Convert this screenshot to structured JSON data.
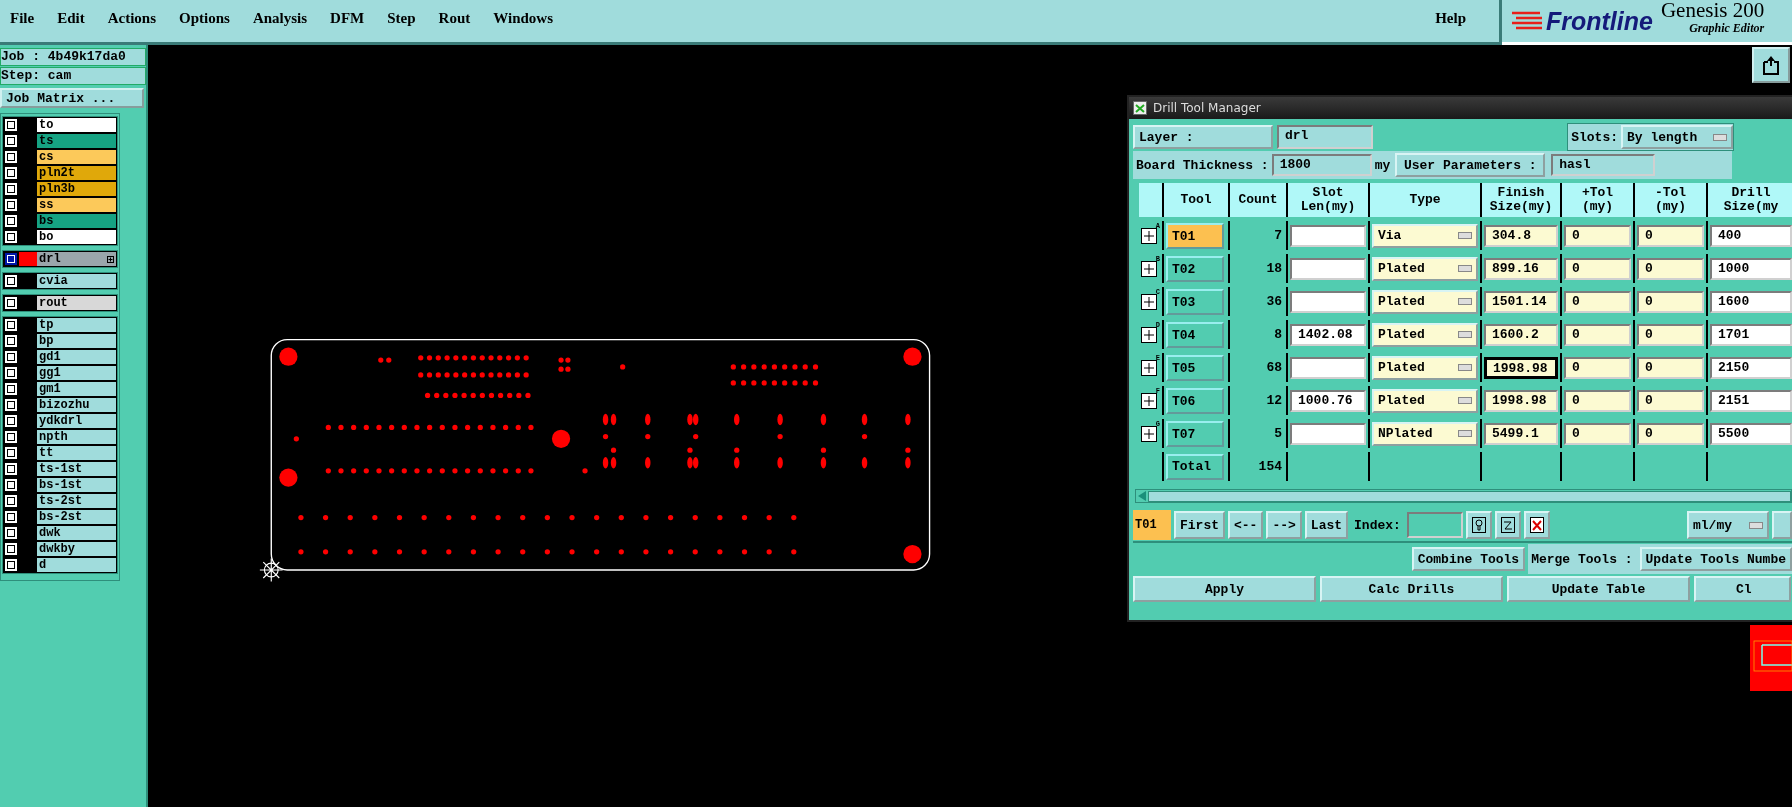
{
  "menu": [
    {
      "label": "File"
    },
    {
      "label": "Edit"
    },
    {
      "label": "Actions"
    },
    {
      "label": "Options"
    },
    {
      "label": "Analysis"
    },
    {
      "label": "DFM"
    },
    {
      "label": "Step"
    },
    {
      "label": "Rout"
    },
    {
      "label": "Windows"
    }
  ],
  "help": "Help",
  "brand": {
    "logo": "Frontline",
    "product": "Genesis 200",
    "subtitle": "Graphic Editor"
  },
  "job": {
    "job": "Job : 4b49k17da0",
    "step": "Step: cam",
    "matrix_button": "Job Matrix ..."
  },
  "layer_groups": [
    {
      "layers": [
        {
          "name": "to",
          "color": "#ffffff",
          "selected": false
        },
        {
          "name": "ts",
          "color": "#16a383",
          "selected": false
        },
        {
          "name": "cs",
          "color": "#fcc95a",
          "selected": false
        },
        {
          "name": "pln2t",
          "color": "#e0a80a",
          "selected": false
        },
        {
          "name": "pln3b",
          "color": "#e0a80a",
          "selected": false
        },
        {
          "name": "ss",
          "color": "#fcc95a",
          "selected": false
        },
        {
          "name": "bs",
          "color": "#16a383",
          "selected": false
        },
        {
          "name": "bo",
          "color": "#ffffff",
          "selected": false
        }
      ]
    },
    {
      "layers": [
        {
          "name": "drl",
          "color": "#9aa6ac",
          "selected": true
        }
      ]
    },
    {
      "layers": [
        {
          "name": "cvia",
          "color": "#a0dcdc",
          "selected": false
        }
      ]
    },
    {
      "layers": [
        {
          "name": "rout",
          "color": "#d8d8d8",
          "selected": false
        }
      ]
    },
    {
      "layers": [
        {
          "name": "tp",
          "color": "#a0dcdc",
          "selected": false
        },
        {
          "name": "bp",
          "color": "#a0dcdc",
          "selected": false
        },
        {
          "name": "gd1",
          "color": "#a0dcdc",
          "selected": false
        },
        {
          "name": "gg1",
          "color": "#a0dcdc",
          "selected": false
        },
        {
          "name": "gm1",
          "color": "#a0dcdc",
          "selected": false
        },
        {
          "name": "bizozhu",
          "color": "#a0dcdc",
          "selected": false
        },
        {
          "name": "ydkdrl",
          "color": "#a0dcdc",
          "selected": false
        },
        {
          "name": "npth",
          "color": "#a0dcdc",
          "selected": false
        },
        {
          "name": "tt",
          "color": "#a0dcdc",
          "selected": false
        },
        {
          "name": "ts-1st",
          "color": "#a0dcdc",
          "selected": false
        },
        {
          "name": "bs-1st",
          "color": "#a0dcdc",
          "selected": false
        },
        {
          "name": "ts-2st",
          "color": "#a0dcdc",
          "selected": false
        },
        {
          "name": "bs-2st",
          "color": "#a0dcdc",
          "selected": false
        },
        {
          "name": "dwk",
          "color": "#a0dcdc",
          "selected": false
        },
        {
          "name": "dwkby",
          "color": "#a0dcdc",
          "selected": false
        },
        {
          "name": "d",
          "color": "#a0dcdc",
          "selected": false
        }
      ]
    }
  ],
  "dialog": {
    "title": "Drill Tool Manager",
    "layer_label": "Layer       :",
    "layer_value": "drl",
    "slots_label": "Slots:",
    "slots_value": "By length",
    "thickness_label": "Board Thickness :",
    "thickness_value": "1800",
    "thickness_unit": "my",
    "user_params_button": "User Parameters :",
    "user_params_value": "hasl",
    "columns": [
      {
        "line1": "Tool"
      },
      {
        "line1": "Count"
      },
      {
        "line1": "Slot",
        "line2": "Len(my)"
      },
      {
        "line1": "Type"
      },
      {
        "line1": "Finish",
        "line2": "Size(my)"
      },
      {
        "line1": "+Tol",
        "line2": "(my)"
      },
      {
        "line1": "-Tol",
        "line2": "(my)"
      },
      {
        "line1": "Drill",
        "line2": "Size(my"
      }
    ],
    "rows": [
      {
        "mark": "A",
        "tool": "T01",
        "selected": true,
        "count": "7",
        "type": "Via",
        "finish": "304.8",
        "finish_focused": false,
        "plus_tol": "0",
        "minus_tol": "0",
        "drill": "400"
      },
      {
        "mark": "B",
        "tool": "T02",
        "selected": false,
        "count": "18",
        "type": "Plated",
        "finish": "899.16",
        "finish_focused": false,
        "plus_tol": "0",
        "minus_tol": "0",
        "drill": "1000"
      },
      {
        "mark": "C",
        "tool": "T03",
        "selected": false,
        "count": "36",
        "type": "Plated",
        "finish": "1501.14",
        "finish_focused": false,
        "plus_tol": "0",
        "minus_tol": "0",
        "drill": "1600"
      },
      {
        "mark": "D",
        "tool": "T04",
        "selected": false,
        "count": "8",
        "slot_len": "1402.08",
        "type": "Plated",
        "finish": "1600.2",
        "finish_focused": false,
        "plus_tol": "0",
        "minus_tol": "0",
        "drill": "1701"
      },
      {
        "mark": "E",
        "tool": "T05",
        "selected": false,
        "count": "68",
        "type": "Plated",
        "finish": "1998.98",
        "finish_focused": true,
        "plus_tol": "0",
        "minus_tol": "0",
        "drill": "2150"
      },
      {
        "mark": "F",
        "tool": "T06",
        "selected": false,
        "count": "12",
        "slot_len": "1000.76",
        "type": "Plated",
        "finish": "1998.98",
        "finish_focused": false,
        "plus_tol": "0",
        "minus_tol": "0",
        "drill": "2151"
      },
      {
        "mark": "G",
        "tool": "T07",
        "selected": false,
        "count": "5",
        "type": "NPlated",
        "finish": "5499.1",
        "finish_focused": false,
        "plus_tol": "0",
        "minus_tol": "0",
        "drill": "5500"
      }
    ],
    "total_label": "Total",
    "total_count": "154",
    "current_tool": "T01",
    "nav_buttons": [
      "First",
      "<--",
      "-->",
      "Last"
    ],
    "index_label": "Index:",
    "units_value": "ml/my",
    "combine_button": "Combine Tools",
    "merge_label": "Merge Tools :",
    "update_numbers_button": "Update Tools Numbe",
    "action_buttons": [
      "Apply",
      "Calc Drills",
      "Update Table",
      "Cl"
    ]
  }
}
